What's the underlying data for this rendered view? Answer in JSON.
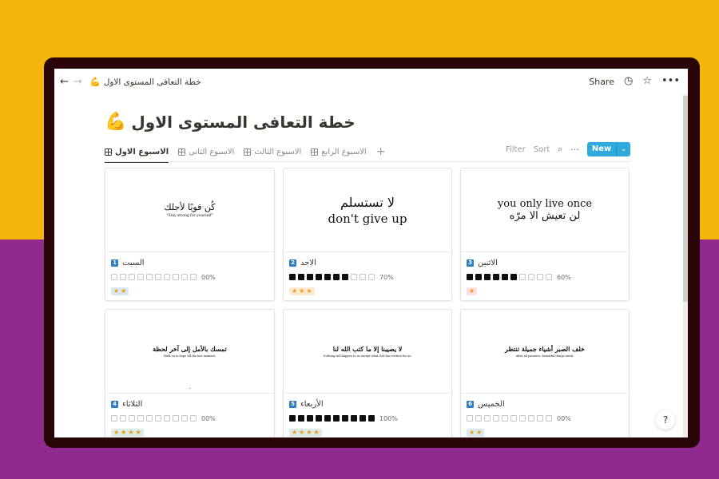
{
  "colors": {
    "bg_top": "#f5b50d",
    "bg_bottom": "#912a8e",
    "device_frame": "#2a0508",
    "accent": "#2eaadc",
    "badge": "#2f7ec1",
    "star": "#f09a12"
  },
  "topbar": {
    "back_icon": "arrow-left-icon",
    "forward_icon": "arrow-right-icon",
    "breadcrumb_emoji": "💪",
    "breadcrumb_title": "خطة التعافى المستوى الاول",
    "share_label": "Share",
    "history_icon": "clock-icon",
    "favorite_icon": "star-outline-icon",
    "more_icon": "ellipsis-icon"
  },
  "page": {
    "emoji": "💪",
    "title": "خطة التعافى المستوى الاول"
  },
  "tabs": [
    {
      "label": "الاسبوع الاول",
      "active": true
    },
    {
      "label": "الاسبوع الثانى",
      "active": false
    },
    {
      "label": "الاسبوع الثالث",
      "active": false
    },
    {
      "label": "الاسبوع الرابع",
      "active": false
    }
  ],
  "add_tab_label": "+",
  "toolbar": {
    "filter_label": "Filter",
    "sort_label": "Sort",
    "search_icon": "search-icon",
    "more_icon": "ellipsis-icon",
    "new_label": "New",
    "new_chevron_icon": "chevron-down-icon"
  },
  "cards": [
    {
      "number": "1",
      "day": "السبت",
      "cover_ar": "كُن قويًا لأجلك",
      "cover_en": "\"Stay strong for yourself\"",
      "progress_filled": 0,
      "progress_total": 10,
      "progress_label": "00%",
      "stars": 2,
      "tag_color": "blue"
    },
    {
      "number": "2",
      "day": "الاحد",
      "cover_ar": "لا تستسلم",
      "cover_en": "don't give up",
      "progress_filled": 7,
      "progress_total": 10,
      "progress_label": "70%",
      "stars": 3,
      "tag_color": "orange"
    },
    {
      "number": "3",
      "day": "الاثنين",
      "cover_en": "you only live once",
      "cover_ar": "لن تعيش الا مرّه",
      "progress_filled": 6,
      "progress_total": 10,
      "progress_label": "60%",
      "stars": 1,
      "tag_color": "pink"
    },
    {
      "number": "4",
      "day": "الثلاثاء",
      "cover_ar": "تمسك بالأمل إلى آخر لحظة",
      "cover_en": "Hold on to hope till the last moment.",
      "cover_sig": "~",
      "progress_filled": 0,
      "progress_total": 10,
      "progress_label": "00%",
      "stars": 4,
      "tag_color": "green"
    },
    {
      "number": "5",
      "day": "الأربعاء",
      "cover_ar": "لا يصيبنا إلا ما كتب الله لنا",
      "cover_en": "Nothing will happen to us except what God has written for us.",
      "progress_filled": 10,
      "progress_total": 10,
      "progress_label": "100%",
      "stars": 4,
      "tag_color": "green"
    },
    {
      "number": "6",
      "day": "الخميس",
      "cover_ar": "خلف الصبر أشياء جميلة تنتظر",
      "cover_en": "After all patience, beautiful things await.",
      "progress_filled": 0,
      "progress_total": 10,
      "progress_label": "00%",
      "stars": 2,
      "tag_color": "blue"
    }
  ],
  "help_label": "?"
}
